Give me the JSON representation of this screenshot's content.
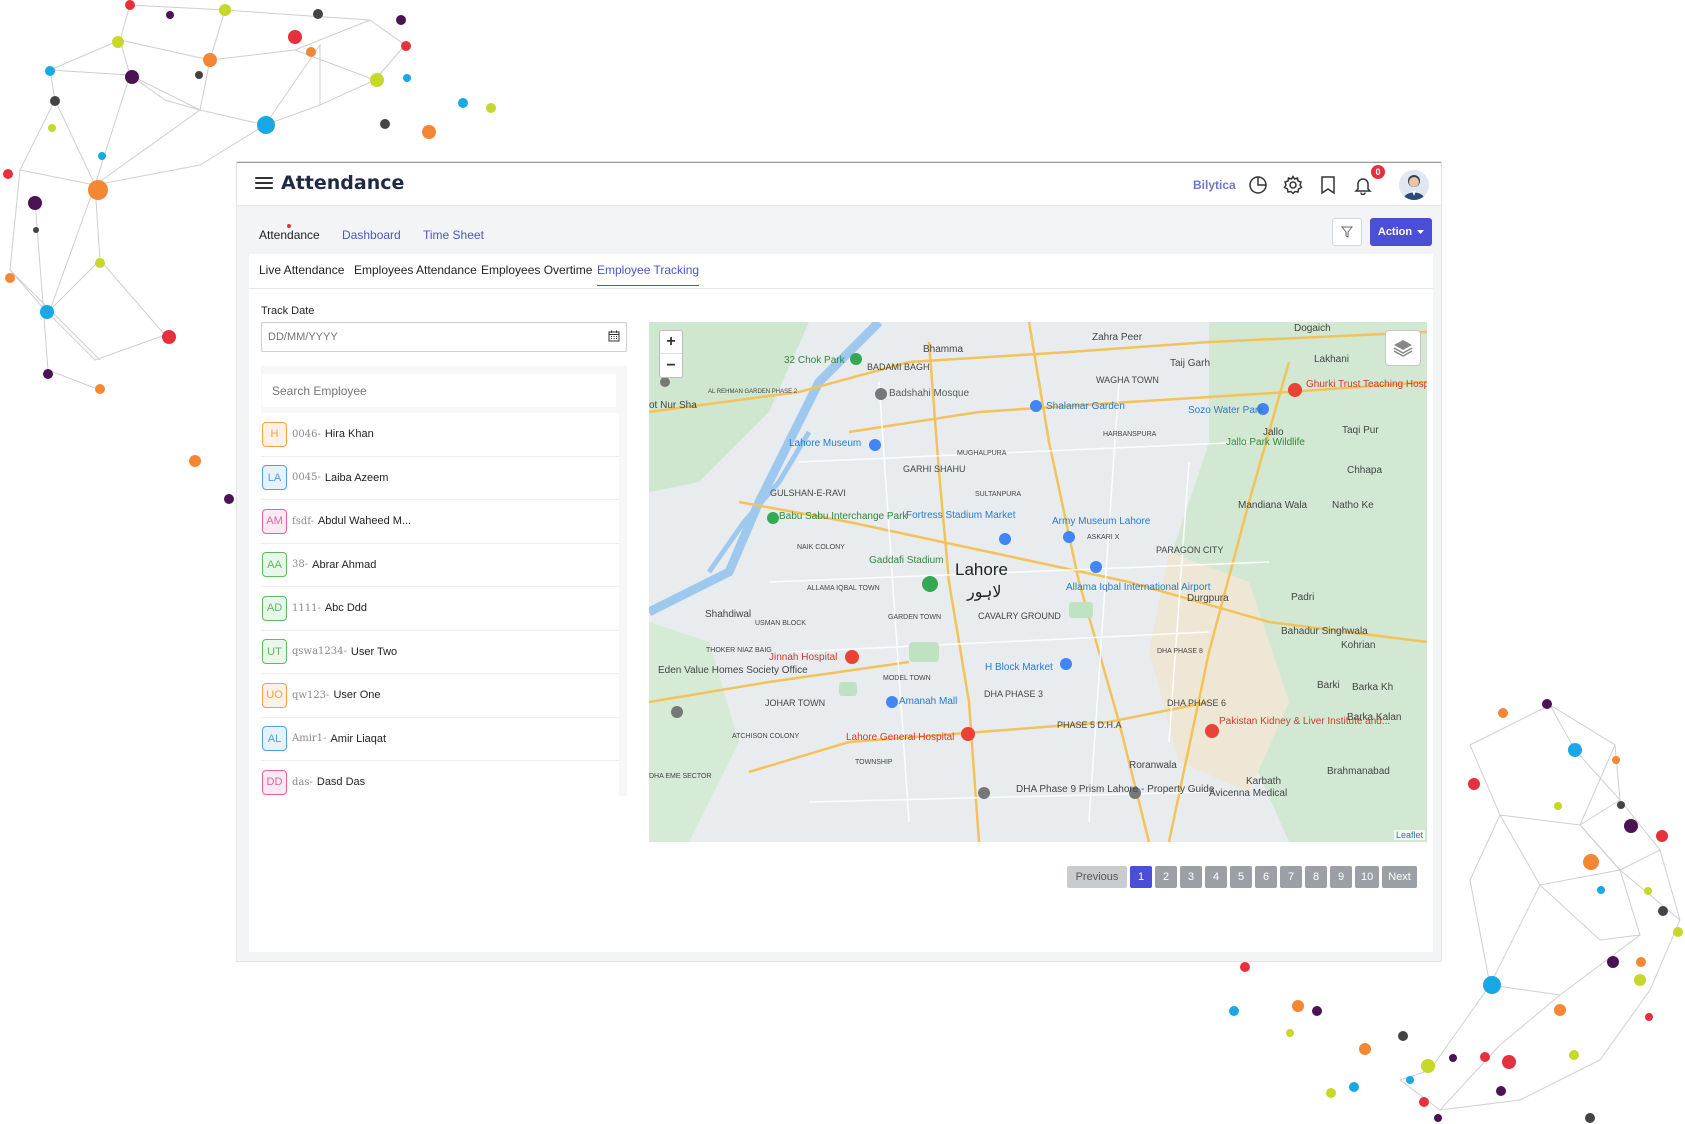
{
  "header": {
    "title": "Attendance",
    "brand": "Bilytica",
    "notification_count": "0"
  },
  "subnav": {
    "items": [
      "Attendance",
      "Dashboard",
      "Time Sheet"
    ],
    "action_label": "Action"
  },
  "tabs": [
    {
      "label": "Live Attendance"
    },
    {
      "label": "Employees Attendance"
    },
    {
      "label": "Employees Overtime"
    },
    {
      "label": "Employee Tracking",
      "active": true
    }
  ],
  "track_date": {
    "label": "Track Date",
    "placeholder": "DD/MM/YYYY"
  },
  "search": {
    "placeholder": "Search Employee"
  },
  "employees": [
    {
      "initials": "H",
      "code": "0046-",
      "name": "Hira Khan",
      "color": "#f5a046"
    },
    {
      "initials": "LA",
      "code": "0045-",
      "name": "Laiba Azeem",
      "color": "#4f9fe6"
    },
    {
      "initials": "AM",
      "code": "fsdf-",
      "name": "Abdul Waheed M...",
      "color": "#e85fa5"
    },
    {
      "initials": "AA",
      "code": "38-",
      "name": "Abrar Ahmad",
      "color": "#5dbb63"
    },
    {
      "initials": "AD",
      "code": "1111-",
      "name": "Abc Ddd",
      "color": "#5dbb63"
    },
    {
      "initials": "UT",
      "code": "qswa1234-",
      "name": "User Two",
      "color": "#5dbb63"
    },
    {
      "initials": "UO",
      "code": "qw123-",
      "name": "User One",
      "color": "#f5a046"
    },
    {
      "initials": "AL",
      "code": "Amir1-",
      "name": "Amir Liaqat",
      "color": "#4f9fe6"
    },
    {
      "initials": "DD",
      "code": "das-",
      "name": "Dasd Das",
      "color": "#e85fa5"
    }
  ],
  "map": {
    "zoom_in": "+",
    "zoom_out": "−",
    "attribution": "Leaflet",
    "labels": [
      {
        "text": "Lahore"
      },
      {
        "text": "لاہور"
      },
      {
        "text": "Bhamma"
      },
      {
        "text": "Zahra Peer"
      },
      {
        "text": "Dogaich"
      },
      {
        "text": "Lakhani"
      },
      {
        "text": "BADAMI BAGH"
      },
      {
        "text": "Badshahi Mosque"
      },
      {
        "text": "32 Chok Park"
      },
      {
        "text": "WAGHA TOWN"
      },
      {
        "text": "Taij Garh"
      },
      {
        "text": "Shalamar Garden"
      },
      {
        "text": "Sozo Water Park"
      },
      {
        "text": "Ghurki Trust Teaching Hosp"
      },
      {
        "text": "Lahore Museum"
      },
      {
        "text": "HARBANSPURA"
      },
      {
        "text": "Jallo Park Wildlife"
      },
      {
        "text": "Jallo"
      },
      {
        "text": "Taqi Pur"
      },
      {
        "text": "GARHI SHAHU"
      },
      {
        "text": "MUGHALPURA"
      },
      {
        "text": "Chhapa"
      },
      {
        "text": "GULSHAN-E-RAVI"
      },
      {
        "text": "SULTANPURA"
      },
      {
        "text": "Babu Sabu Interchange Park"
      },
      {
        "text": "Fortress Stadium Market"
      },
      {
        "text": "Army Museum Lahore"
      },
      {
        "text": "Mandiana Wala"
      },
      {
        "text": "Natho Ke"
      },
      {
        "text": "NAIK COLONY"
      },
      {
        "text": "ASKARI X"
      },
      {
        "text": "PARAGON CITY"
      },
      {
        "text": "Gaddafi Stadium"
      },
      {
        "text": "ALLAMA IQBAL TOWN"
      },
      {
        "text": "Allama Iqbal International Airport"
      },
      {
        "text": "Durgpura"
      },
      {
        "text": "Padri"
      },
      {
        "text": "Shahdiwal"
      },
      {
        "text": "USMAN BLOCK"
      },
      {
        "text": "GARDEN TOWN"
      },
      {
        "text": "CAVALRY GROUND"
      },
      {
        "text": "Bahadur Singhwala"
      },
      {
        "text": "THOKER NIAZ BAIG"
      },
      {
        "text": "Jinnah Hospital"
      },
      {
        "text": "H Block Market"
      },
      {
        "text": "DHA PHASE 8"
      },
      {
        "text": "Kohrian"
      },
      {
        "text": "Eden Value Homes Society Office"
      },
      {
        "text": "MODEL TOWN"
      },
      {
        "text": "DHA PHASE 3"
      },
      {
        "text": "DHA PHASE 6"
      },
      {
        "text": "Barki"
      },
      {
        "text": "Barka Kh"
      },
      {
        "text": "JOHAR TOWN"
      },
      {
        "text": "Amanah Mall"
      },
      {
        "text": "PHASE 5 D.H.A"
      },
      {
        "text": "Pakistan Kidney & Liver Institute and..."
      },
      {
        "text": "Barka Kalan"
      },
      {
        "text": "ATCHISON COLONY"
      },
      {
        "text": "Lahore General Hospital"
      },
      {
        "text": "TOWNSHIP"
      },
      {
        "text": "Roranwala"
      },
      {
        "text": "Brahmanabad"
      },
      {
        "text": "DHA EME SECTOR"
      },
      {
        "text": "DHA Phase 9 Prism Lahore - Property Guide"
      },
      {
        "text": "Avicenna Medical"
      },
      {
        "text": "Karbath"
      },
      {
        "text": "ot Nur Sha"
      },
      {
        "text": "AL REHMAN GARDEN PHASE 2"
      }
    ]
  },
  "pagination": {
    "previous": "Previous",
    "pages": [
      "1",
      "2",
      "3",
      "4",
      "5",
      "6",
      "7",
      "8",
      "9",
      "10"
    ],
    "next": "Next",
    "current": "1"
  }
}
